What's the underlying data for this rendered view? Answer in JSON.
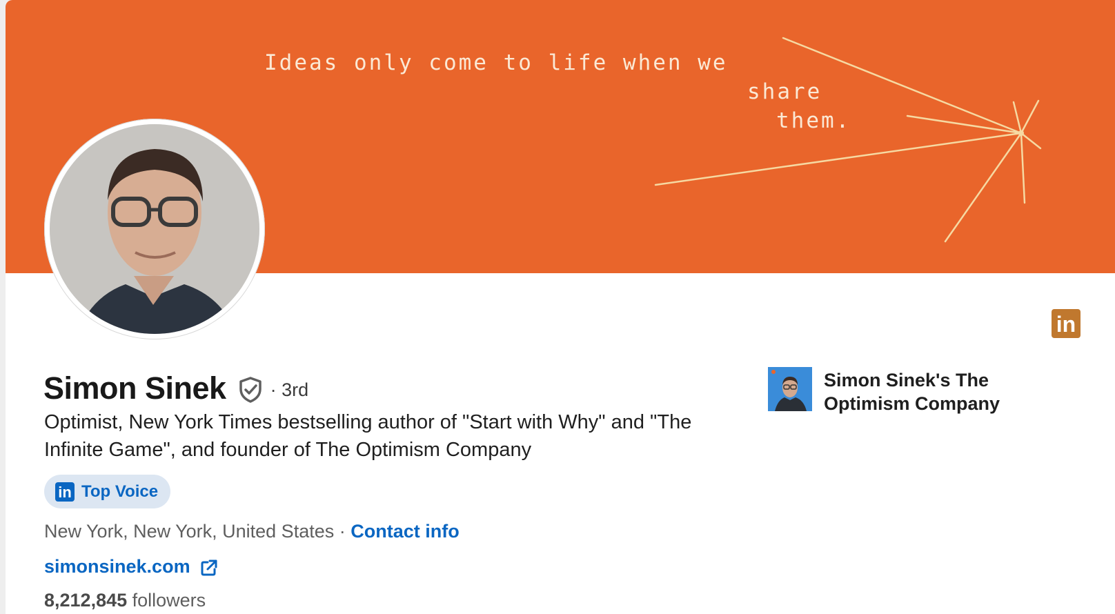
{
  "banner": {
    "quote_line1": "Ideas only come to life when we",
    "quote_line2": "share",
    "quote_line3": "them."
  },
  "profile": {
    "name": "Simon Sinek",
    "degree": "· 3rd",
    "headline": "Optimist, New York Times bestselling author of \"Start with Why\" and \"The Infinite Game\", and founder of The Optimism Company",
    "top_voice_label": "Top Voice",
    "location": "New York, New York, United States",
    "location_separator": " · ",
    "contact_info_label": "Contact info",
    "website": "simonsinek.com",
    "followers_count": "8,212,845",
    "followers_label": "followers"
  },
  "company": {
    "name": "Simon Sinek's The Optimism Company"
  },
  "icons": {
    "linkedin_badge": "in",
    "top_voice_icon": "in"
  },
  "colors": {
    "banner": "#e9652b",
    "link": "#0a66c2",
    "badge_bg": "#dce6f2",
    "linkedin_gold": "#c0782e"
  }
}
